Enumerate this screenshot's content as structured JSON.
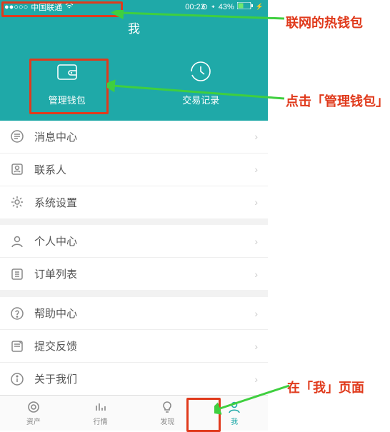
{
  "status": {
    "carrier": "中国联通",
    "time": "00:23",
    "battery": "43%"
  },
  "header": {
    "title": "我",
    "manage_wallet": "管理钱包",
    "tx_history": "交易记录"
  },
  "menu": {
    "g1": [
      {
        "label": "消息中心"
      },
      {
        "label": "联系人"
      },
      {
        "label": "系统设置"
      }
    ],
    "g2": [
      {
        "label": "个人中心"
      },
      {
        "label": "订单列表"
      }
    ],
    "g3": [
      {
        "label": "帮助中心"
      },
      {
        "label": "提交反馈"
      },
      {
        "label": "关于我们"
      }
    ]
  },
  "tabs": {
    "assets": "资产",
    "market": "行情",
    "discover": "发现",
    "me": "我"
  },
  "annotations": {
    "a1": "联网的热钱包",
    "a2": "点击「管理钱包」",
    "a3": "在「我」页面"
  }
}
